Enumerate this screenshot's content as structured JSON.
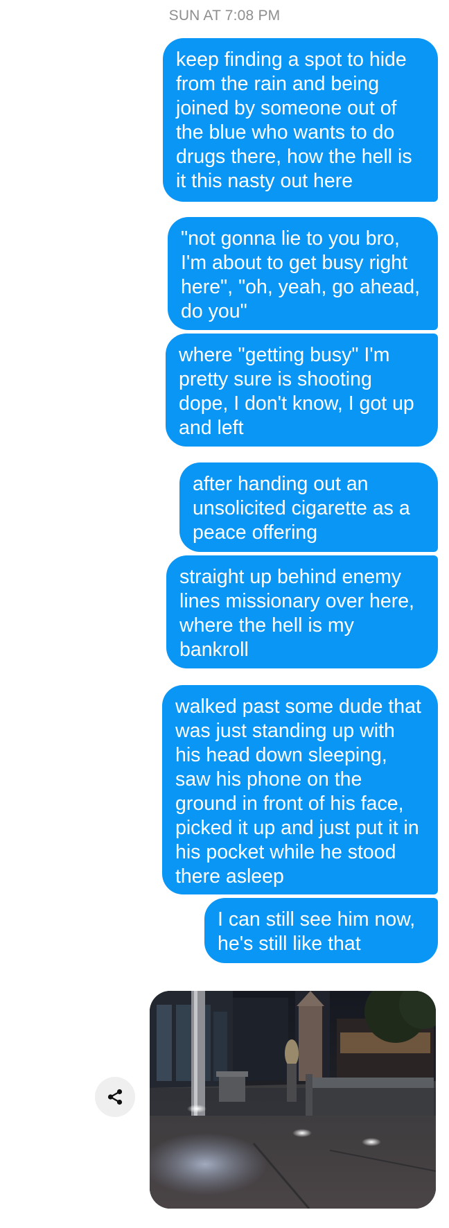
{
  "thread": {
    "timestamp": "SUN AT 7:08 PM",
    "messages": [
      {
        "text": "keep finding a spot to hide from the rain and being joined by someone out of the blue who wants to do drugs there, how the hell is it this nasty out here"
      },
      {
        "text": "\"not gonna lie to you bro, I'm about to get busy right here\", \"oh, yeah, go ahead, do you\""
      },
      {
        "text": "where \"getting busy\" I'm pretty sure is shooting dope, I don't know, I got up and left"
      },
      {
        "text": "after handing out an unsolicited cigarette as a peace offering"
      },
      {
        "text": "straight up behind enemy lines missionary over here, where the hell is my bankroll"
      },
      {
        "text": "walked past some dude that was just standing up with his head down sleeping, saw his phone on the ground in front of his face, picked it up and just put it in his pocket while he stood there asleep"
      },
      {
        "text": "I can still see him now, he's still like that"
      }
    ],
    "attachment": {
      "type": "photo",
      "share_icon": "share-icon"
    }
  },
  "colors": {
    "bubble": "#0a96f5",
    "bubble_text": "#ffffff",
    "timestamp": "#8e8e8e",
    "share_bg": "#efefef"
  }
}
